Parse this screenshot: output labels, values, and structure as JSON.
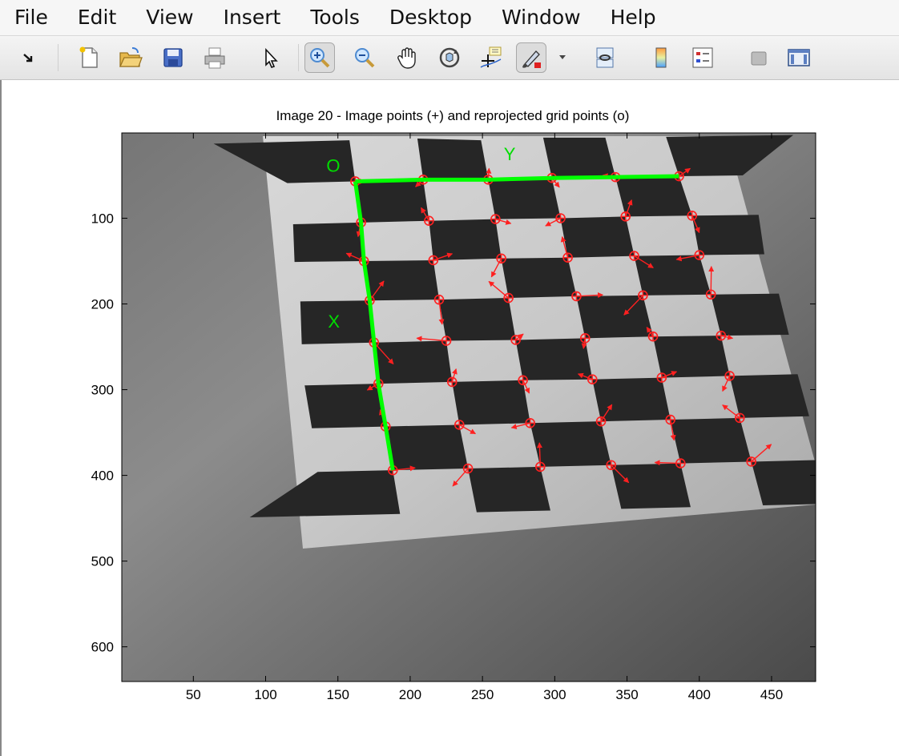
{
  "menubar": {
    "items": [
      "File",
      "Edit",
      "View",
      "Insert",
      "Tools",
      "Desktop",
      "Window",
      "Help"
    ]
  },
  "toolbar": {
    "buttons": [
      {
        "name": "dock-arrow-icon"
      },
      {
        "name": "new-figure-icon"
      },
      {
        "name": "open-file-icon"
      },
      {
        "name": "save-icon"
      },
      {
        "name": "print-icon"
      },
      {
        "name": "edit-plot-arrow-icon"
      },
      {
        "name": "zoom-in-icon",
        "pressed": true
      },
      {
        "name": "zoom-out-icon"
      },
      {
        "name": "pan-hand-icon"
      },
      {
        "name": "rotate-3d-icon"
      },
      {
        "name": "data-cursor-icon"
      },
      {
        "name": "brush-icon"
      },
      {
        "name": "link-plot-icon"
      },
      {
        "name": "colorbar-icon"
      },
      {
        "name": "legend-icon"
      },
      {
        "name": "hide-plot-tools-icon"
      },
      {
        "name": "show-plot-tools-icon"
      }
    ]
  },
  "figure": {
    "title": "Image 20 - Image points (+) and reprojected grid points (o)",
    "grid_labels": {
      "origin": "O",
      "x": "X",
      "y": "Y"
    },
    "colors": {
      "axis_lines": "#00ff00",
      "markers": "#ff2020",
      "label_text": "#00dd00"
    }
  },
  "chart_data": {
    "type": "scatter",
    "title": "Image 20 - Image points (+) and reprojected grid points (o)",
    "xlabel": "",
    "ylabel": "",
    "x_ticks": [
      50,
      100,
      150,
      200,
      250,
      300,
      350,
      400,
      450
    ],
    "y_ticks": [
      100,
      200,
      300,
      400,
      500,
      600
    ],
    "xlim": [
      0.5,
      480.5
    ],
    "ylim": [
      0.5,
      640.5
    ],
    "y_reversed": true,
    "x_axis": {
      "range": [
        0.5,
        480.5
      ],
      "ticks": [
        50,
        100,
        150,
        200,
        250,
        300,
        350,
        400,
        450
      ]
    },
    "y_axis": {
      "range": [
        0.5,
        640.5
      ],
      "ticks": [
        100,
        200,
        300,
        400,
        500,
        600
      ],
      "reversed": true
    },
    "grid": false,
    "legend": "none",
    "points": [
      {
        "x": 162,
        "y": 57
      },
      {
        "x": 209,
        "y": 55
      },
      {
        "x": 254,
        "y": 55
      },
      {
        "x": 298,
        "y": 53
      },
      {
        "x": 342,
        "y": 52
      },
      {
        "x": 386,
        "y": 51
      },
      {
        "x": 166,
        "y": 105
      },
      {
        "x": 213,
        "y": 103
      },
      {
        "x": 259,
        "y": 101
      },
      {
        "x": 304,
        "y": 100
      },
      {
        "x": 349,
        "y": 98
      },
      {
        "x": 395,
        "y": 97
      },
      {
        "x": 168,
        "y": 150
      },
      {
        "x": 216,
        "y": 149
      },
      {
        "x": 263,
        "y": 147
      },
      {
        "x": 309,
        "y": 146
      },
      {
        "x": 355,
        "y": 144
      },
      {
        "x": 400,
        "y": 143
      },
      {
        "x": 172,
        "y": 196
      },
      {
        "x": 220,
        "y": 195
      },
      {
        "x": 268,
        "y": 193
      },
      {
        "x": 315,
        "y": 191
      },
      {
        "x": 361,
        "y": 190
      },
      {
        "x": 408,
        "y": 189
      },
      {
        "x": 175,
        "y": 245
      },
      {
        "x": 225,
        "y": 243
      },
      {
        "x": 273,
        "y": 242
      },
      {
        "x": 321,
        "y": 240
      },
      {
        "x": 368,
        "y": 238
      },
      {
        "x": 415,
        "y": 237
      },
      {
        "x": 178,
        "y": 293
      },
      {
        "x": 229,
        "y": 291
      },
      {
        "x": 278,
        "y": 289
      },
      {
        "x": 326,
        "y": 288
      },
      {
        "x": 374,
        "y": 286
      },
      {
        "x": 421,
        "y": 284
      },
      {
        "x": 183,
        "y": 343
      },
      {
        "x": 234,
        "y": 341
      },
      {
        "x": 283,
        "y": 339
      },
      {
        "x": 332,
        "y": 337
      },
      {
        "x": 380,
        "y": 335
      },
      {
        "x": 428,
        "y": 333
      },
      {
        "x": 188,
        "y": 394
      },
      {
        "x": 240,
        "y": 392
      },
      {
        "x": 290,
        "y": 390
      },
      {
        "x": 339,
        "y": 388
      },
      {
        "x": 387,
        "y": 386
      },
      {
        "x": 436,
        "y": 384
      }
    ]
  }
}
